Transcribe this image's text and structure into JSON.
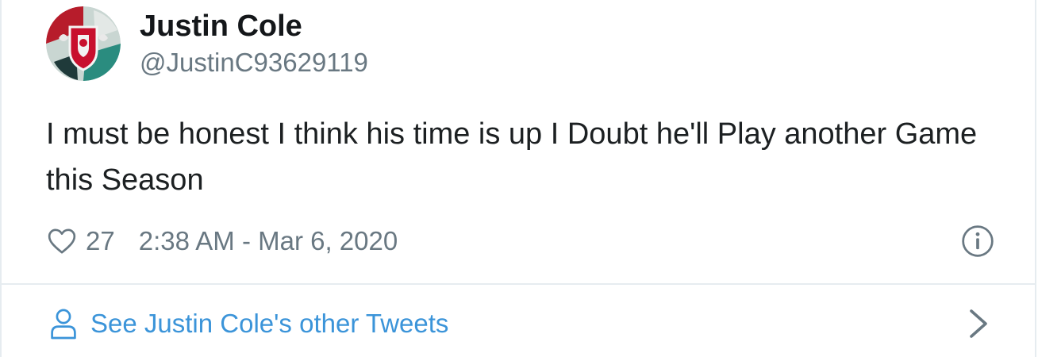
{
  "tweet": {
    "author_name": "Justin Cole",
    "author_handle": "@JustinC93629119",
    "text": "I must be honest I think his time is up I Doubt he'll Play another Game this Season",
    "like_count": "27",
    "timestamp": "2:38 AM - Mar 6, 2020"
  },
  "footer": {
    "link_label": "See Justin Cole's other Tweets"
  },
  "icons": {
    "like": "heart-icon",
    "info": "info-icon",
    "profile": "person-icon",
    "next": "chevron-right-icon"
  },
  "colors": {
    "text": "#1c2022",
    "muted": "#697882",
    "link": "#3b94d9",
    "border": "#e6ecf0"
  }
}
